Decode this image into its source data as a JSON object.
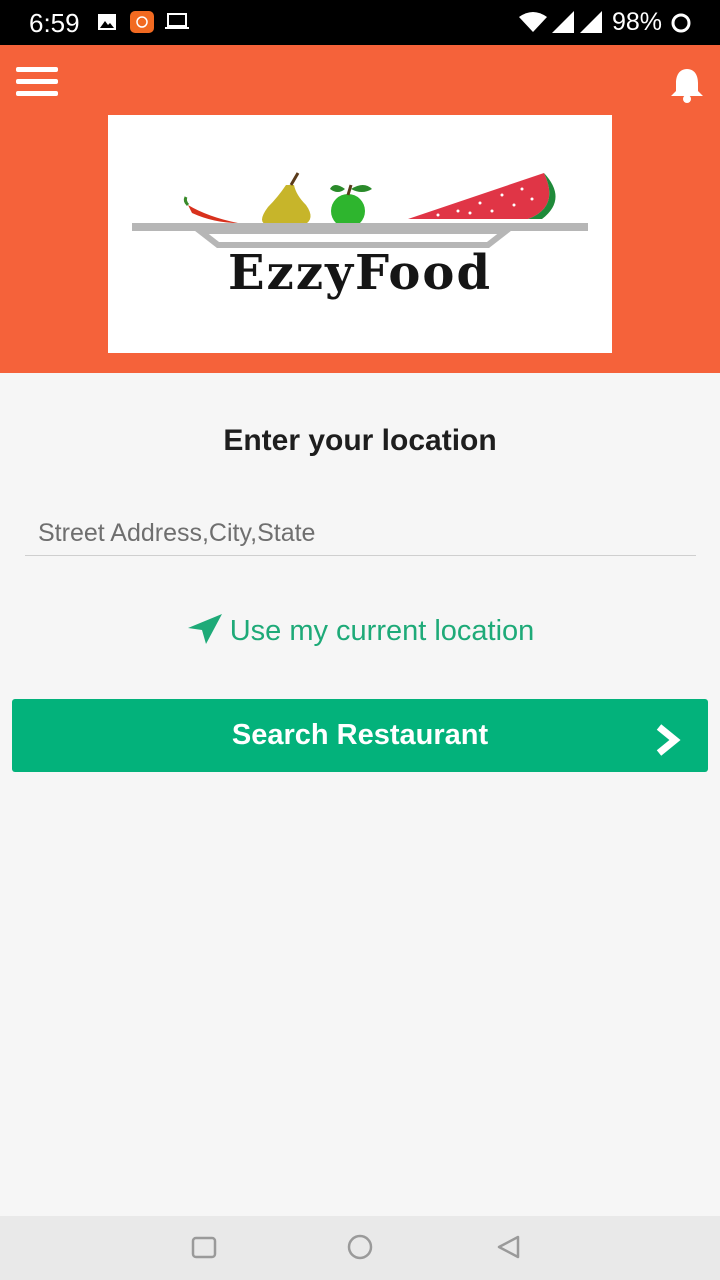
{
  "status_bar": {
    "time": "6:59",
    "battery": "98%",
    "icons": [
      "image-icon",
      "app-notification-icon",
      "laptop-icon",
      "wifi-icon",
      "signal-icon",
      "signal-icon",
      "battery-icon"
    ]
  },
  "header": {
    "background": "#f5623a",
    "menu_icon": "menu-icon",
    "bell_icon": "bell-icon",
    "logo_text": "EzzyFood"
  },
  "main": {
    "title": "Enter your location",
    "address_placeholder": "Street Address,City,State",
    "address_value": "",
    "current_location_label": "Use my current location",
    "current_location_icon": "navigation-arrow-icon",
    "search_button_label": "Search Restaurant",
    "search_button_icon": "chevron-right-icon",
    "accent_color": "#1eaa78",
    "button_color": "#03b27b"
  },
  "nav_bar": {
    "icons": [
      "recents-square-icon",
      "home-circle-icon",
      "back-triangle-icon"
    ]
  }
}
